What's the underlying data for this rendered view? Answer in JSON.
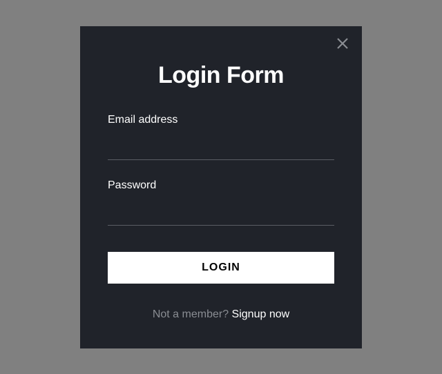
{
  "modal": {
    "title": "Login Form",
    "fields": {
      "email": {
        "label": "Email address"
      },
      "password": {
        "label": "Password"
      }
    },
    "submit_label": "LOGIN",
    "footer": {
      "prompt": "Not a member? ",
      "link_text": "Signup now"
    }
  }
}
